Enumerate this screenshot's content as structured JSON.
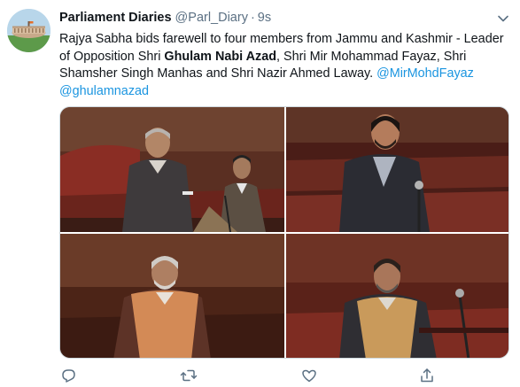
{
  "tweet": {
    "display_name": "Parliament Diaries",
    "handle": "@Parl_Diary",
    "separator": "·",
    "time": "9s",
    "text": {
      "p1": "Rajya Sabha bids farewell to four members from Jammu and Kashmir - Leader of Opposition Shri ",
      "bold": "Ghulam Nabi Azad",
      "p2": ", Shri Mir Mohammad Fayaz, Shri Shamsher Singh Manhas and Shri Nazir Ahmed Laway. ",
      "mention1": "@MirMohdFayaz",
      "mention2": "@ghulamnazad"
    }
  },
  "icons": {
    "more": "chevron-down-icon",
    "reply": "reply-icon",
    "retweet": "retweet-icon",
    "like": "heart-icon",
    "share": "share-icon"
  },
  "colors": {
    "link": "#1b95e0",
    "secondary_text": "#5b7083",
    "bench_red": "#7a2a22"
  }
}
